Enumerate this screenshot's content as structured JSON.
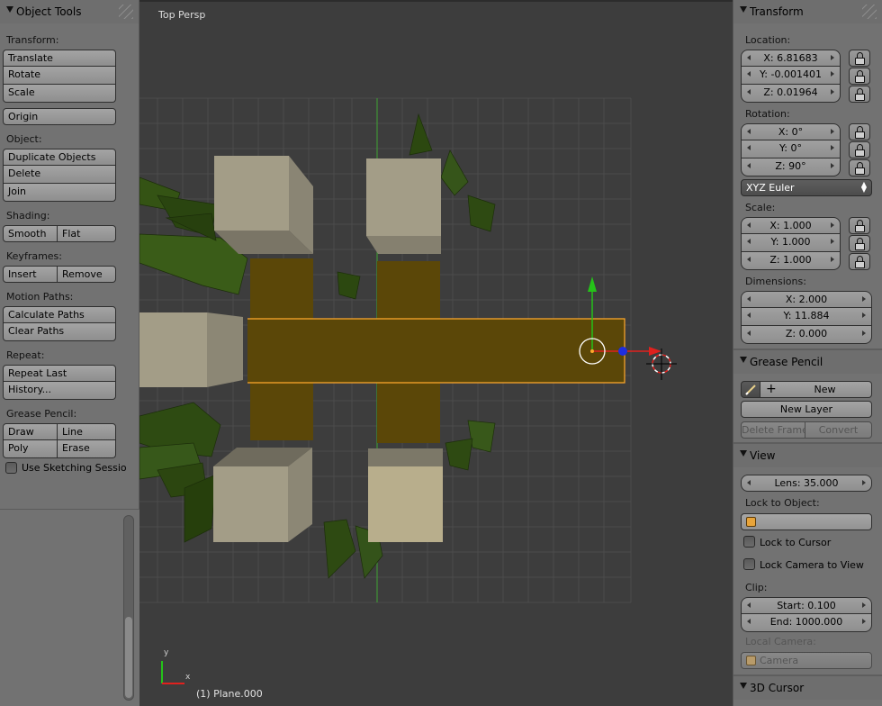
{
  "left_panel": {
    "title": "Object Tools",
    "transform": {
      "label": "Transform:",
      "translate": "Translate",
      "rotate": "Rotate",
      "scale": "Scale",
      "origin": "Origin"
    },
    "object": {
      "label": "Object:",
      "duplicate": "Duplicate Objects",
      "delete": "Delete",
      "join": "Join"
    },
    "shading": {
      "label": "Shading:",
      "smooth": "Smooth",
      "flat": "Flat"
    },
    "keyframes": {
      "label": "Keyframes:",
      "insert": "Insert",
      "remove": "Remove"
    },
    "motion_paths": {
      "label": "Motion Paths:",
      "calculate": "Calculate Paths",
      "clear": "Clear Paths"
    },
    "repeat": {
      "label": "Repeat:",
      "repeat_last": "Repeat Last",
      "history": "History..."
    },
    "grease_pencil": {
      "label": "Grease Pencil:",
      "draw": "Draw",
      "line": "Line",
      "poly": "Poly",
      "erase": "Erase",
      "use_sketching": "Use Sketching Sessio"
    }
  },
  "viewport": {
    "view_name": "Top Persp",
    "status": "(1) Plane.000",
    "axis_x": "x",
    "axis_y": "y"
  },
  "right_panel": {
    "transform": {
      "title": "Transform",
      "location_label": "Location:",
      "location": {
        "x": "X: 6.81683",
        "y": "Y: -0.001401",
        "z": "Z: 0.01964"
      },
      "rotation_label": "Rotation:",
      "rotation": {
        "x": "X: 0°",
        "y": "Y: 0°",
        "z": "Z: 90°"
      },
      "rotation_mode": "XYZ Euler",
      "scale_label": "Scale:",
      "scale": {
        "x": "X: 1.000",
        "y": "Y: 1.000",
        "z": "Z: 1.000"
      },
      "dimensions_label": "Dimensions:",
      "dimensions": {
        "x": "X: 2.000",
        "y": "Y: 11.884",
        "z": "Z: 0.000"
      }
    },
    "grease_pencil": {
      "title": "Grease Pencil",
      "new": "New",
      "new_layer": "New Layer",
      "delete_frame": "Delete Frame",
      "convert": "Convert"
    },
    "view": {
      "title": "View",
      "lens": "Lens: 35.000",
      "lock_to_object_label": "Lock to Object:",
      "lock_to_cursor": "Lock to Cursor",
      "lock_camera_to_view": "Lock Camera to View",
      "clip_label": "Clip:",
      "clip_start": "Start: 0.100",
      "clip_end": "End: 1000.000",
      "local_camera_label": "Local Camera:",
      "local_camera_value": "Camera"
    },
    "cursor": {
      "title": "3D Cursor"
    }
  },
  "colors": {
    "panel_bg": "#727272",
    "viewport_bg": "#3d3d3d",
    "selected_plane": "#5b4708",
    "selection_outline": "#ffa82c",
    "cube": "#a09a86",
    "foliage": "#2e4a12",
    "axis_x": "#e0211e",
    "axis_y": "#25c219",
    "axis_z": "#1f2ee0"
  }
}
